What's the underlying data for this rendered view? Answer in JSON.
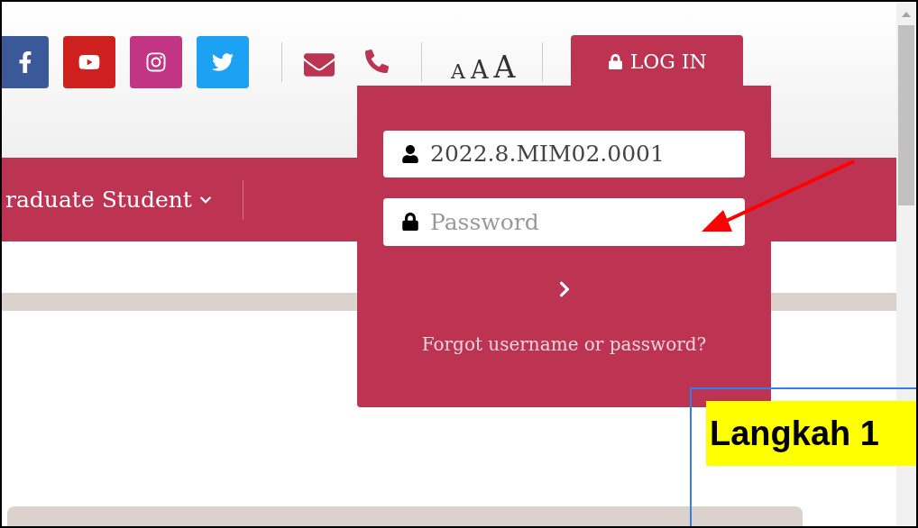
{
  "header": {
    "social_links": [
      {
        "kind": "facebook",
        "color": "#3b5998"
      },
      {
        "kind": "youtube",
        "color": "#cd201f"
      },
      {
        "kind": "instagram",
        "color": "#c13584"
      },
      {
        "kind": "twitter",
        "color": "#1da1f2"
      }
    ],
    "contact_icons": [
      {
        "kind": "mail"
      },
      {
        "kind": "phone"
      }
    ],
    "font_size_buttons": [
      "A",
      "A",
      "A"
    ],
    "login_tab": "LOG IN"
  },
  "nav": {
    "items": [
      {
        "label": "raduate Student"
      }
    ]
  },
  "login_panel": {
    "username": "2022.8.MIM02.0001",
    "password_placeholder": "Password",
    "forgot_link": "Forgot username or password?"
  },
  "annotation": {
    "label": "Langkah 1"
  }
}
